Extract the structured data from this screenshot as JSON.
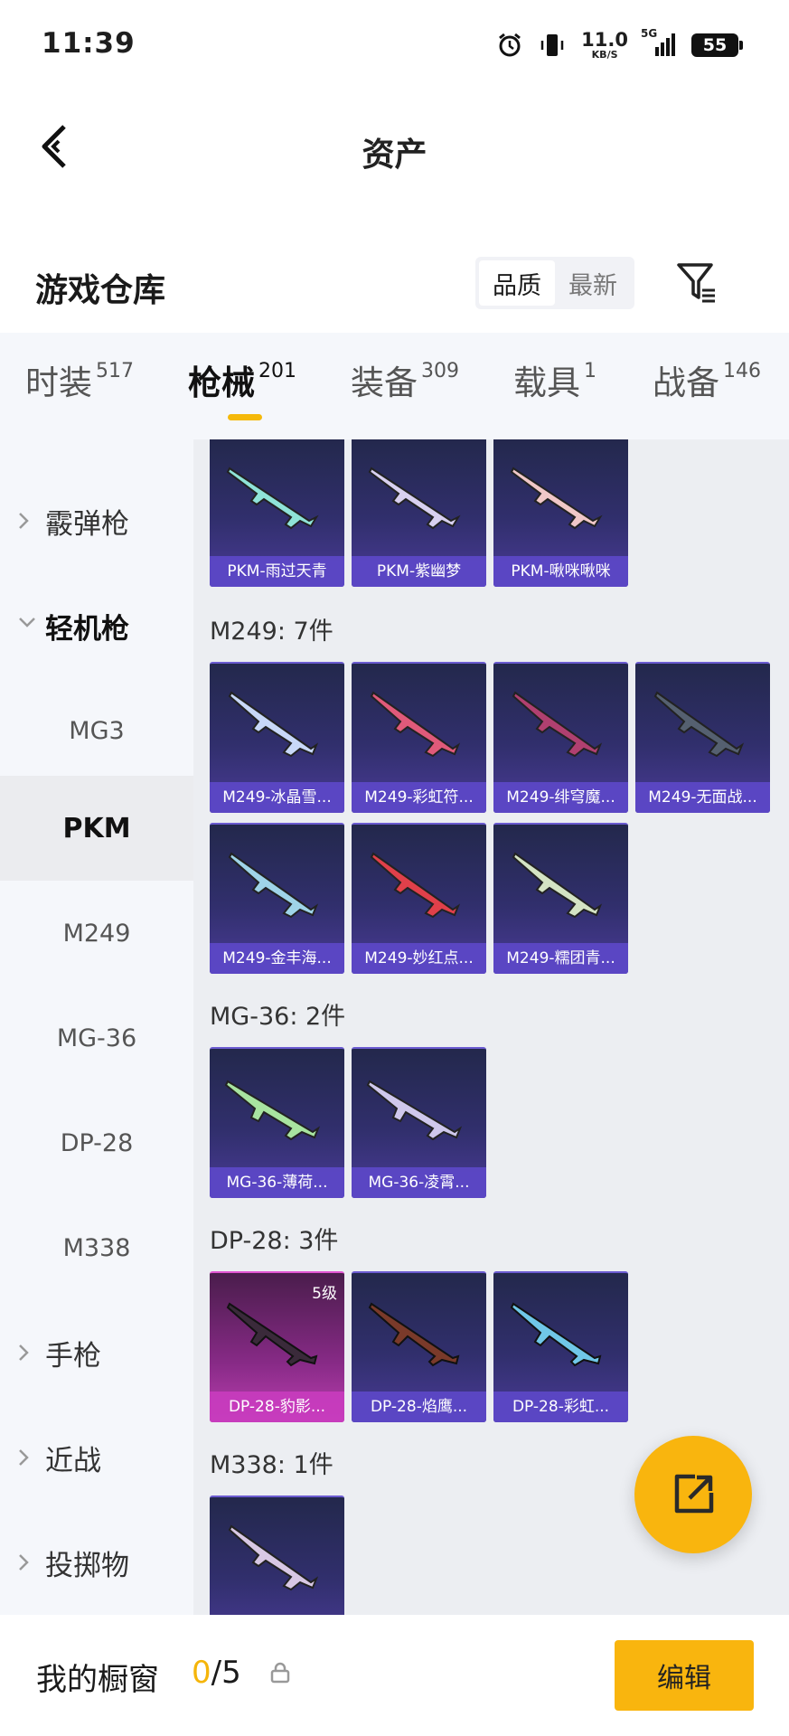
{
  "status_bar": {
    "time": "11:39",
    "net_speed_value": "11.0",
    "net_speed_unit": "KB/S",
    "network": "5G",
    "battery": "55"
  },
  "header": {
    "title": "资产"
  },
  "section": {
    "title": "游戏仓库",
    "sort_options": [
      "品质",
      "最新"
    ],
    "active_sort": "品质"
  },
  "tabs": [
    {
      "label": "时装",
      "count": "517"
    },
    {
      "label": "枪械",
      "count": "201",
      "active": true
    },
    {
      "label": "装备",
      "count": "309"
    },
    {
      "label": "载具",
      "count": "1"
    },
    {
      "label": "战备",
      "count": "146"
    }
  ],
  "sidebar": {
    "items": [
      {
        "label": "霰弹枪",
        "type": "group"
      },
      {
        "label": "轻机枪",
        "type": "group",
        "expanded": true
      },
      {
        "label": "MG3",
        "type": "sub"
      },
      {
        "label": "PKM",
        "type": "sub",
        "active": true
      },
      {
        "label": "M249",
        "type": "sub"
      },
      {
        "label": "MG-36",
        "type": "sub"
      },
      {
        "label": "DP-28",
        "type": "sub"
      },
      {
        "label": "M338",
        "type": "sub"
      },
      {
        "label": "手枪",
        "type": "group"
      },
      {
        "label": "近战",
        "type": "group"
      },
      {
        "label": "投掷物",
        "type": "group"
      }
    ]
  },
  "groups": [
    {
      "title": "",
      "items": [
        {
          "name": "PKM-雨过天青"
        },
        {
          "name": "PKM-紫幽梦"
        },
        {
          "name": "PKM-啾咪啾咪"
        }
      ]
    },
    {
      "title": "M249: 7件",
      "items": [
        {
          "name": "M249-冰晶雪..."
        },
        {
          "name": "M249-彩虹符..."
        },
        {
          "name": "M249-绯穹魔..."
        },
        {
          "name": "M249-无面战..."
        },
        {
          "name": "M249-金丰海..."
        },
        {
          "name": "M249-妙红点..."
        },
        {
          "name": "M249-糯团青..."
        }
      ]
    },
    {
      "title": "MG-36: 2件",
      "items": [
        {
          "name": "MG-36-薄荷..."
        },
        {
          "name": "MG-36-凌霄..."
        }
      ]
    },
    {
      "title": "DP-28: 3件",
      "items": [
        {
          "name": "DP-28-豹影...",
          "level": "5级",
          "rarity": "pink"
        },
        {
          "name": "DP-28-焰鹰..."
        },
        {
          "name": "DP-28-彩虹..."
        }
      ]
    },
    {
      "title": "M338: 1件",
      "items": [
        {
          "name": ""
        }
      ]
    }
  ],
  "bottom": {
    "showcase_label": "我的橱窗",
    "showcase_current": "0",
    "showcase_total": "/5",
    "edit_label": "编辑"
  },
  "colors": {
    "accent": "#f9b50e",
    "card_label_bg": "#5c48c8",
    "card_pink": "#bb3fb0"
  },
  "icons": {
    "back": "back-chevron-icon",
    "filter": "filter-icon",
    "share": "share-out-icon",
    "lock": "lock-icon"
  }
}
